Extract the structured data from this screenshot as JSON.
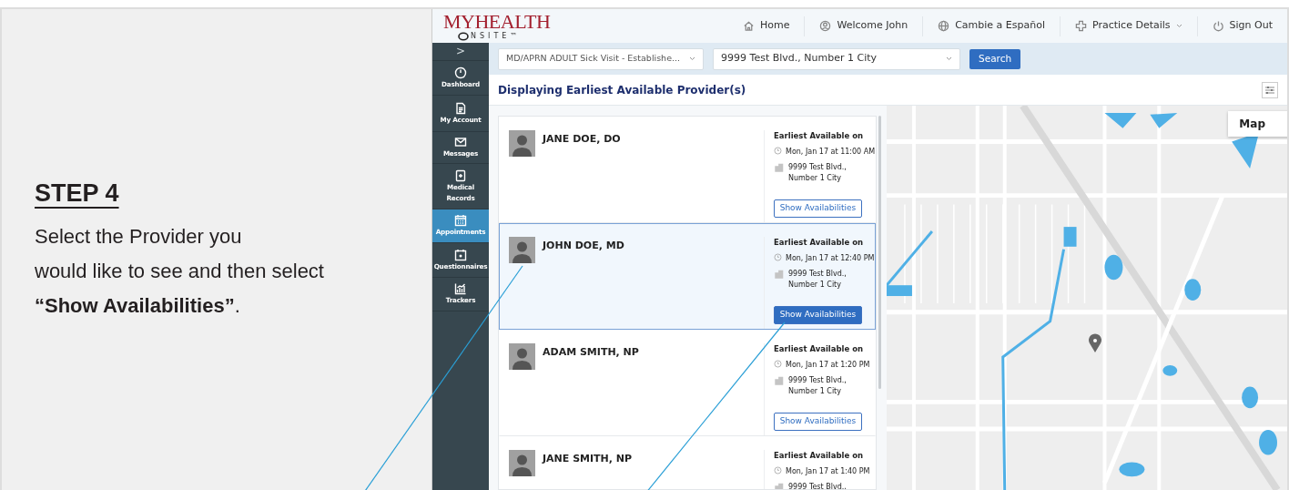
{
  "step": {
    "heading": "STEP 4",
    "text_lines": [
      "Select the Provider you",
      "would like to see and then select",
      "**“Show Availabilities”**."
    ]
  },
  "app": {
    "logo": {
      "title": "MYHEALTH",
      "subtitle": "NSITE™"
    },
    "nav": [
      {
        "kind": "home",
        "label": "Home"
      },
      {
        "kind": "user",
        "label": "Welcome John"
      },
      {
        "kind": "globe",
        "label": "Cambie a Español"
      },
      {
        "kind": "cross",
        "label": "Practice Details",
        "dropdown": true
      },
      {
        "kind": "power",
        "label": "Sign Out"
      }
    ],
    "sidebar": {
      "toggle": ">",
      "items": [
        {
          "kind": "gauge",
          "label": "Dashboard",
          "selected": false
        },
        {
          "kind": "document",
          "label": "My Account",
          "selected": false
        },
        {
          "kind": "envelope",
          "label": "Messages",
          "selected": false
        },
        {
          "kind": "record",
          "label": "Medical Records",
          "selected": false
        },
        {
          "kind": "calendar",
          "label": "Appointments",
          "selected": true
        },
        {
          "kind": "star-calendar",
          "label": "Questionnaires",
          "selected": false
        },
        {
          "kind": "chart",
          "label": "Trackers",
          "selected": false
        }
      ]
    },
    "search": {
      "visit_type": "MD/APRN ADULT Sick Visit - Establishe...",
      "location": "9999 Test Blvd., Number 1 City",
      "button": "Search"
    },
    "heading": "Displaying Earliest Available Provider(s)",
    "providers": [
      {
        "name": "JANE DOE, DO",
        "selected": false,
        "available_label": "Earliest Available on",
        "time": "Mon, Jan 17 at 11:00 AM",
        "address": [
          "9999 Test Blvd.,",
          "Number 1 City"
        ],
        "button": "Show Availabilities"
      },
      {
        "name": "JOHN DOE, MD",
        "selected": true,
        "available_label": "Earliest Available on",
        "time": "Mon, Jan 17 at 12:40 PM",
        "address": [
          "9999 Test Blvd.,",
          "Number 1 City"
        ],
        "button": "Show Availabilities"
      },
      {
        "name": "ADAM SMITH, NP",
        "selected": false,
        "available_label": "Earliest Available on",
        "time": "Mon, Jan 17 at 1:20 PM",
        "address": [
          "9999 Test Blvd.,",
          "Number 1 City"
        ],
        "button": "Show Availabilities"
      },
      {
        "name": "JANE SMITH, NP",
        "selected": false,
        "available_label": "Earliest Available on",
        "time": "Mon, Jan 17 at 1:40 PM",
        "address": [
          "9999 Test Blvd.,"
        ]
      }
    ],
    "map": {
      "type_control": "Map"
    }
  }
}
